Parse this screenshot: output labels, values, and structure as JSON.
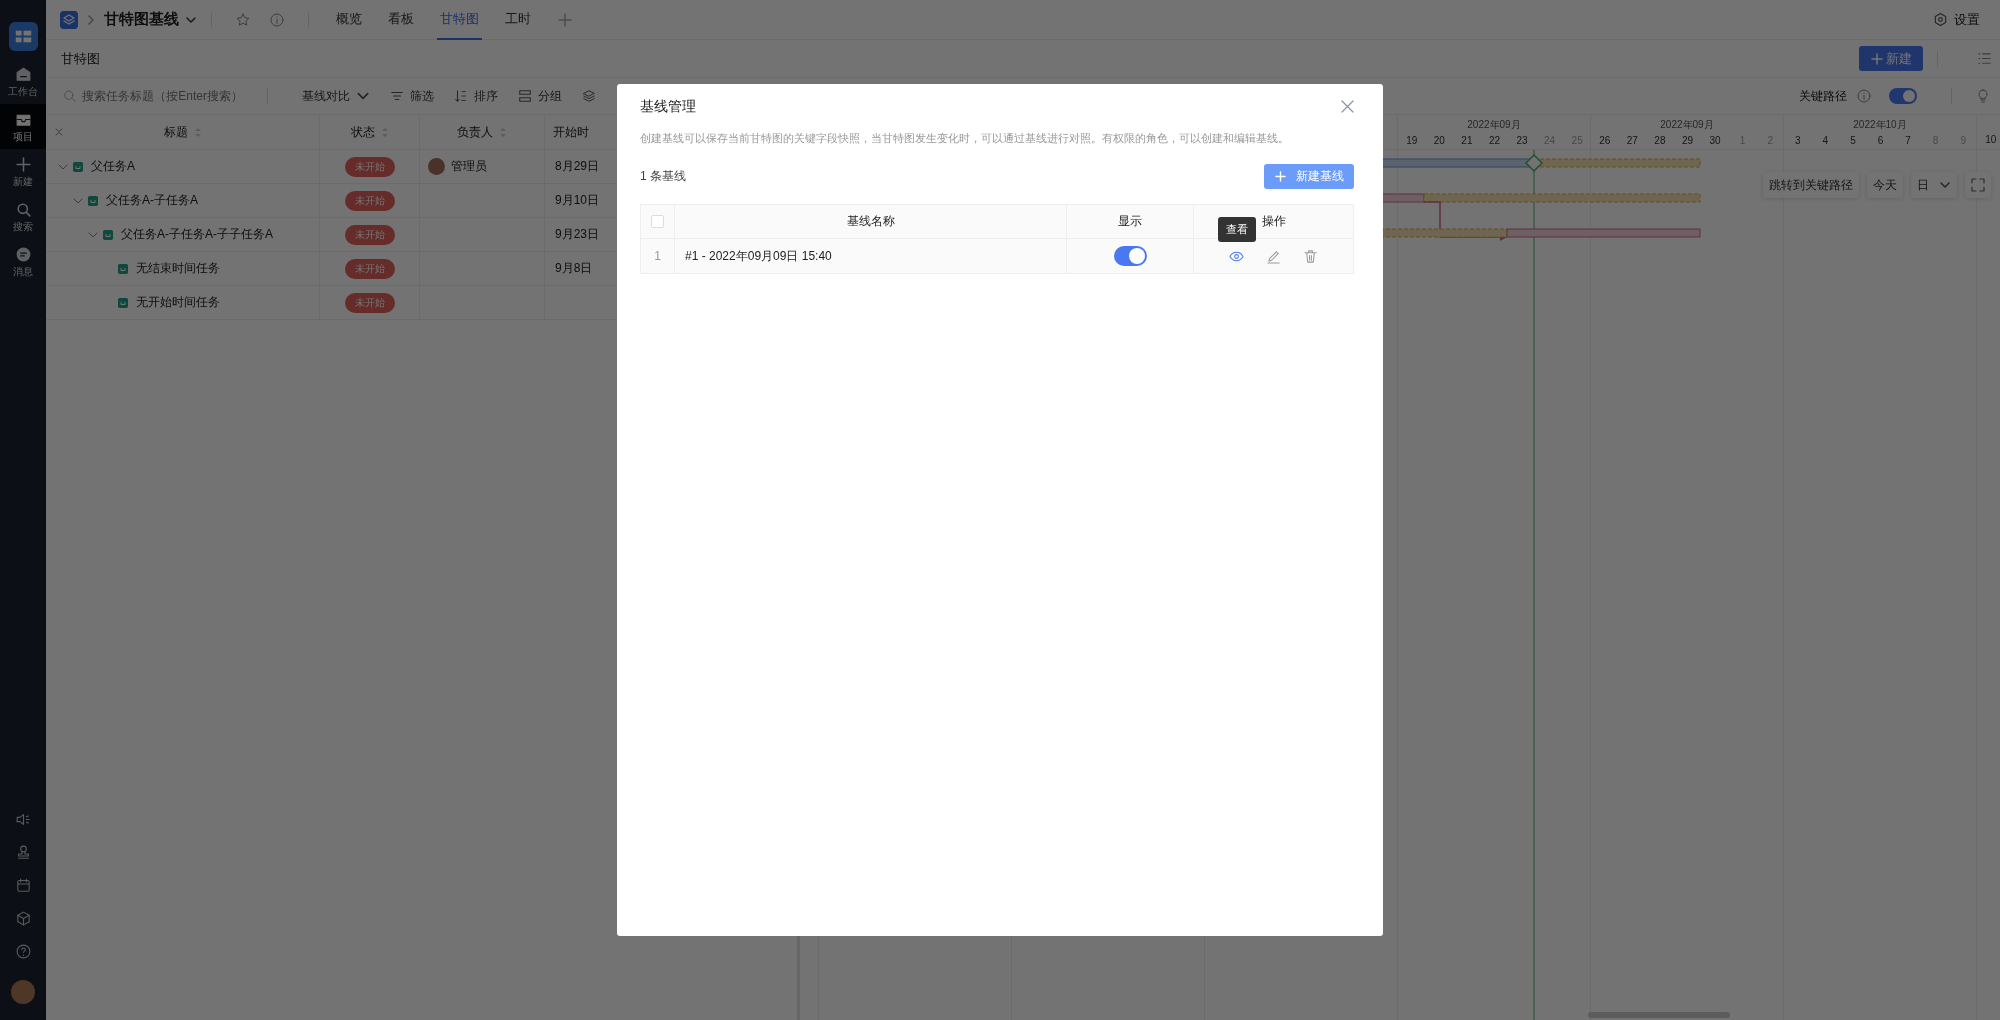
{
  "sidebar": {
    "items": [
      {
        "label": "工作台",
        "selected": false
      },
      {
        "label": "项目",
        "selected": true
      },
      {
        "label": "新建",
        "selected": false
      },
      {
        "label": "搜索",
        "selected": false
      },
      {
        "label": "消息",
        "selected": false
      }
    ]
  },
  "header": {
    "project_title": "甘特图基线",
    "tabs": [
      {
        "label": "概览",
        "selected": false
      },
      {
        "label": "看板",
        "selected": false
      },
      {
        "label": "甘特图",
        "selected": true
      },
      {
        "label": "工时",
        "selected": false
      }
    ],
    "settings_label": "设置"
  },
  "page_title": "甘特图",
  "new_button": "新建",
  "toolbar": {
    "search_placeholder": "搜索任务标题（按Enter搜索）",
    "items": [
      {
        "kind": "dropdown",
        "label": "基线对比"
      },
      {
        "kind": "filter",
        "label": "筛选"
      },
      {
        "kind": "sort",
        "label": "排序"
      },
      {
        "kind": "group",
        "label": "分组"
      }
    ],
    "critical_path": {
      "label": "关键路径",
      "on": true
    }
  },
  "table": {
    "columns": [
      "标题",
      "状态",
      "负责人",
      "开始时"
    ],
    "rows": [
      {
        "title": "父任务A",
        "status": "未开始",
        "owner": "管理员",
        "start": "8月29日",
        "expanded": true,
        "children": [
          {
            "title": "父任务A-子任务A",
            "status": "未开始",
            "start": "9月10日",
            "expanded": true,
            "children": [
              {
                "title": "父任务A-子任务A-子子任务A",
                "status": "未开始",
                "start": "9月23日",
                "expanded": true,
                "children": [
                  {
                    "title": "无结束时间任务",
                    "status": "未开始",
                    "start": "9月8日"
                  },
                  {
                    "title": "无开始时间任务",
                    "status": "未开始"
                  }
                ]
              }
            ]
          }
        ]
      }
    ]
  },
  "gantt": {
    "weeks": [
      {
        "month": "2022年09月",
        "days": [
          {
            "label": "19",
            "weekend": false
          },
          {
            "label": "20",
            "weekend": false
          },
          {
            "label": "21",
            "weekend": false
          },
          {
            "label": "22",
            "weekend": false
          },
          {
            "label": "23",
            "weekend": false
          },
          {
            "label": "24",
            "weekend": true
          },
          {
            "label": "25",
            "weekend": true
          }
        ]
      },
      {
        "month": "2022年09月",
        "days": [
          {
            "label": "26",
            "weekend": false
          },
          {
            "label": "27",
            "weekend": false
          },
          {
            "label": "28",
            "weekend": false
          },
          {
            "label": "29",
            "weekend": false
          },
          {
            "label": "30",
            "weekend": false
          },
          {
            "label": "1",
            "weekend": true
          },
          {
            "label": "2",
            "weekend": true
          }
        ]
      },
      {
        "month": "2022年10月",
        "days": [
          {
            "label": "3",
            "weekend": false
          },
          {
            "label": "4",
            "weekend": false
          },
          {
            "label": "5",
            "weekend": false
          },
          {
            "label": "6",
            "weekend": false
          },
          {
            "label": "7",
            "weekend": false
          },
          {
            "label": "8",
            "weekend": true
          },
          {
            "label": "9",
            "weekend": true
          }
        ]
      },
      {
        "days": [
          {
            "label": "10",
            "weekend": false
          }
        ]
      }
    ],
    "jump_button": "跳转到关键路径",
    "today_button": "今天",
    "scale": "日"
  },
  "dialog": {
    "title": "基线管理",
    "description": "创建基线可以保存当前甘特图的关键字段快照，当甘特图发生变化时，可以通过基线进行对照。有权限的角色，可以创建和编辑基线。",
    "count": "1 条基线",
    "new_button": "新建基线",
    "select_all_checked": false,
    "columns": [
      "基线名称",
      "显示",
      "操作"
    ],
    "rows": [
      {
        "index": "1",
        "name": "#1 - 2022年09月09日 15:40",
        "shown": true
      }
    ],
    "tooltip": "查看"
  }
}
